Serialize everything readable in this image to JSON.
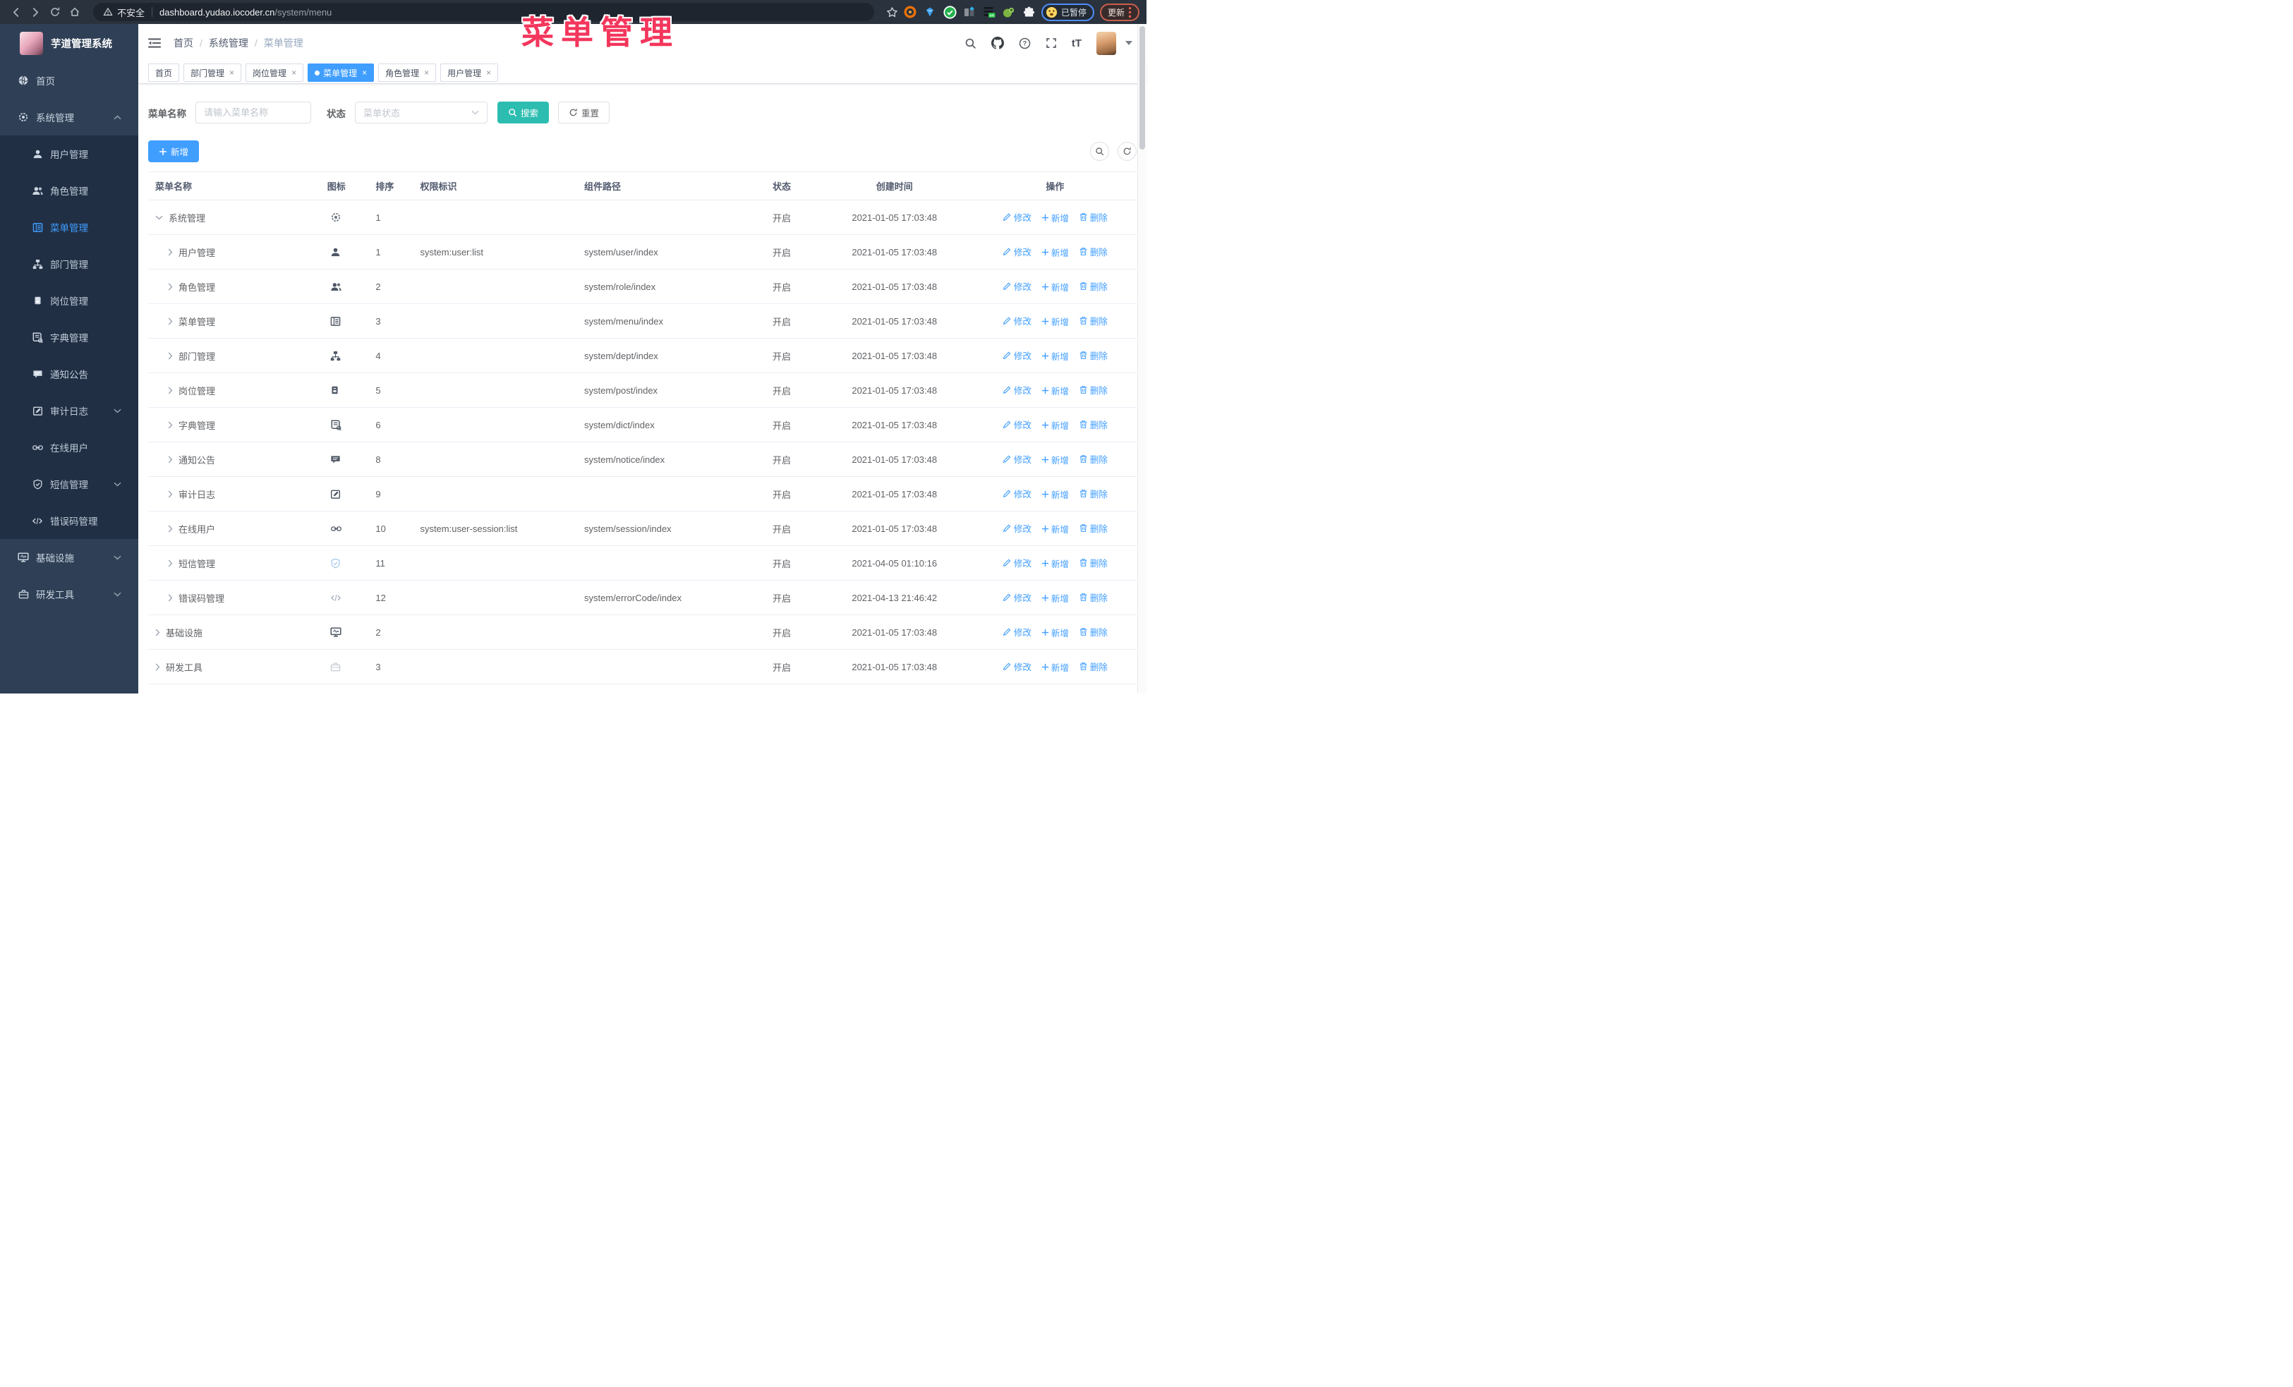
{
  "browser": {
    "security_label": "不安全",
    "url_host": "dashboard.yudao.iocoder.cn",
    "url_path": "/system/menu",
    "extensions": [
      "orange-ring-icon",
      "blue-gem-icon",
      "green-check-icon",
      "tab-switcher-icon",
      "list-on-icon",
      "green-creature-icon",
      "puzzle-icon"
    ],
    "paused_label": "已暂停",
    "update_label": "更新"
  },
  "overlay_title": "菜单管理",
  "sidebar": {
    "logo_title": "芋道管理系统",
    "items": [
      {
        "label": "首页",
        "icon": "home-earth-icon",
        "type": "root",
        "caret": "",
        "active": false
      },
      {
        "label": "系统管理",
        "icon": "gear-icon",
        "type": "root",
        "caret": "up",
        "active": false
      },
      {
        "label": "用户管理",
        "icon": "user-icon",
        "type": "sub",
        "caret": "",
        "active": false
      },
      {
        "label": "角色管理",
        "icon": "users-icon",
        "type": "sub",
        "caret": "",
        "active": false
      },
      {
        "label": "菜单管理",
        "icon": "menu-tree-icon",
        "type": "sub",
        "caret": "",
        "active": true
      },
      {
        "label": "部门管理",
        "icon": "org-tree-icon",
        "type": "sub",
        "caret": "",
        "active": false
      },
      {
        "label": "岗位管理",
        "icon": "badge-icon",
        "type": "sub",
        "caret": "",
        "active": false
      },
      {
        "label": "字典管理",
        "icon": "dict-book-icon",
        "type": "sub",
        "caret": "",
        "active": false
      },
      {
        "label": "通知公告",
        "icon": "notice-icon",
        "type": "sub",
        "caret": "",
        "active": false
      },
      {
        "label": "审计日志",
        "icon": "audit-log-icon",
        "type": "sub",
        "caret": "down",
        "active": false
      },
      {
        "label": "在线用户",
        "icon": "online-user-icon",
        "type": "sub",
        "caret": "",
        "active": false
      },
      {
        "label": "短信管理",
        "icon": "sms-shield-icon",
        "type": "sub",
        "caret": "down",
        "active": false
      },
      {
        "label": "错误码管理",
        "icon": "error-code-icon",
        "type": "sub",
        "caret": "",
        "active": false
      },
      {
        "label": "基础设施",
        "icon": "infra-monitor-icon",
        "type": "root",
        "caret": "down",
        "active": false
      },
      {
        "label": "研发工具",
        "icon": "dev-tools-icon",
        "type": "root",
        "caret": "down",
        "active": false
      }
    ]
  },
  "breadcrumb": {
    "items": [
      "首页",
      "系统管理",
      "菜单管理"
    ],
    "separator": "/"
  },
  "tabs": [
    {
      "label": "首页",
      "closable": false,
      "active": false
    },
    {
      "label": "部门管理",
      "closable": true,
      "active": false
    },
    {
      "label": "岗位管理",
      "closable": true,
      "active": false
    },
    {
      "label": "菜单管理",
      "closable": true,
      "active": true
    },
    {
      "label": "角色管理",
      "closable": true,
      "active": false
    },
    {
      "label": "用户管理",
      "closable": true,
      "active": false
    }
  ],
  "filters": {
    "name_label": "菜单名称",
    "name_placeholder": "请输入菜单名称",
    "status_label": "状态",
    "status_placeholder": "菜单状态",
    "search_label": "搜索",
    "reset_label": "重置"
  },
  "toolbar": {
    "add_label": "新增"
  },
  "table": {
    "headers": [
      "菜单名称",
      "图标",
      "排序",
      "权限标识",
      "组件路径",
      "状态",
      "创建时间",
      "操作"
    ],
    "action_labels": {
      "edit": "修改",
      "add": "新增",
      "delete": "删除"
    },
    "rows": [
      {
        "name": "系统管理",
        "level": 0,
        "caret": "down",
        "icon": "gear-icon",
        "icon_tint": "#6b7480",
        "sort": "1",
        "perm": "",
        "path": "",
        "status": "开启",
        "time": "2021-01-05 17:03:48"
      },
      {
        "name": "用户管理",
        "level": 1,
        "caret": "right",
        "icon": "user-icon",
        "icon_tint": "#4d5664",
        "sort": "1",
        "perm": "system:user:list",
        "path": "system/user/index",
        "status": "开启",
        "time": "2021-01-05 17:03:48"
      },
      {
        "name": "角色管理",
        "level": 1,
        "caret": "right",
        "icon": "users-icon",
        "icon_tint": "#4d5664",
        "sort": "2",
        "perm": "",
        "path": "system/role/index",
        "status": "开启",
        "time": "2021-01-05 17:03:48"
      },
      {
        "name": "菜单管理",
        "level": 1,
        "caret": "right",
        "icon": "menu-tree-icon",
        "icon_tint": "#4d5664",
        "sort": "3",
        "perm": "",
        "path": "system/menu/index",
        "status": "开启",
        "time": "2021-01-05 17:03:48"
      },
      {
        "name": "部门管理",
        "level": 1,
        "caret": "right",
        "icon": "org-tree-icon",
        "icon_tint": "#4d5664",
        "sort": "4",
        "perm": "",
        "path": "system/dept/index",
        "status": "开启",
        "time": "2021-01-05 17:03:48"
      },
      {
        "name": "岗位管理",
        "level": 1,
        "caret": "right",
        "icon": "badge-icon",
        "icon_tint": "#4d5664",
        "sort": "5",
        "perm": "",
        "path": "system/post/index",
        "status": "开启",
        "time": "2021-01-05 17:03:48"
      },
      {
        "name": "字典管理",
        "level": 1,
        "caret": "right",
        "icon": "dict-book-icon",
        "icon_tint": "#4d5664",
        "sort": "6",
        "perm": "",
        "path": "system/dict/index",
        "status": "开启",
        "time": "2021-01-05 17:03:48"
      },
      {
        "name": "通知公告",
        "level": 1,
        "caret": "right",
        "icon": "notice-icon",
        "icon_tint": "#4d5664",
        "sort": "8",
        "perm": "",
        "path": "system/notice/index",
        "status": "开启",
        "time": "2021-01-05 17:03:48"
      },
      {
        "name": "审计日志",
        "level": 1,
        "caret": "right",
        "icon": "audit-log-icon",
        "icon_tint": "#4d5664",
        "sort": "9",
        "perm": "",
        "path": "",
        "status": "开启",
        "time": "2021-01-05 17:03:48"
      },
      {
        "name": "在线用户",
        "level": 1,
        "caret": "right",
        "icon": "online-user-icon",
        "icon_tint": "#4d5664",
        "sort": "10",
        "perm": "system:user-session:list",
        "path": "system/session/index",
        "status": "开启",
        "time": "2021-01-05 17:03:48"
      },
      {
        "name": "短信管理",
        "level": 1,
        "caret": "right",
        "icon": "sms-shield-icon",
        "icon_tint": "#a6c9f0",
        "sort": "11",
        "perm": "",
        "path": "",
        "status": "开启",
        "time": "2021-04-05 01:10:16"
      },
      {
        "name": "错误码管理",
        "level": 1,
        "caret": "right",
        "icon": "error-code-icon",
        "icon_tint": "#a7aeb8",
        "sort": "12",
        "perm": "",
        "path": "system/errorCode/index",
        "status": "开启",
        "time": "2021-04-13 21:46:42"
      },
      {
        "name": "基础设施",
        "level": 0,
        "caret": "right",
        "icon": "infra-monitor-icon",
        "icon_tint": "#4d5664",
        "sort": "2",
        "perm": "",
        "path": "",
        "status": "开启",
        "time": "2021-01-05 17:03:48"
      },
      {
        "name": "研发工具",
        "level": 0,
        "caret": "right",
        "icon": "dev-tools-icon",
        "icon_tint": "#c6cbd3",
        "sort": "3",
        "perm": "",
        "path": "",
        "status": "开启",
        "time": "2021-01-05 17:03:48"
      }
    ]
  },
  "colors": {
    "primary": "#409eff",
    "search_button": "#2cbdb0",
    "overlay": "#f4365c",
    "sidebar_bg": "#2f4056",
    "submenu_bg": "#212f44",
    "status_text": "#606266"
  }
}
